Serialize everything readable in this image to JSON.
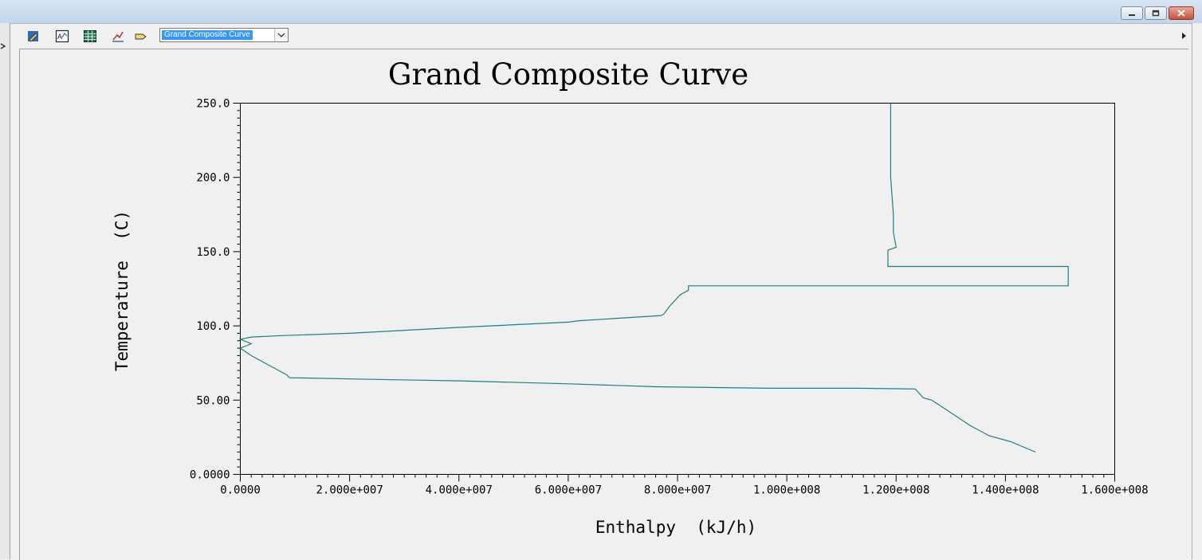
{
  "window": {
    "controls": [
      "minimize",
      "restore",
      "close"
    ]
  },
  "toolbar": {
    "icons": [
      "edit-icon",
      "format-chart-icon",
      "table-icon",
      "graph-control-icon",
      "label-icon"
    ],
    "chart_select": {
      "value": "Grand Composite Curve"
    }
  },
  "colors": {
    "curve": "#1f7f80",
    "axis": "#000000",
    "background": "#f0f0f0"
  },
  "chart_data": {
    "type": "line",
    "title": "Grand Composite Curve",
    "xlabel": "Enthalpy  (kJ/h)",
    "ylabel": "Temperature  (C)",
    "xlim": [
      0,
      160000000
    ],
    "ylim": [
      0,
      250
    ],
    "x_tick_labels": [
      "0.0000",
      "2.000e+007",
      "4.000e+007",
      "6.000e+007",
      "8.000e+007",
      "1.000e+008",
      "1.200e+008",
      "1.400e+008",
      "1.600e+008"
    ],
    "y_tick_labels": [
      "0.0000",
      "50.00",
      "100.0",
      "150.0",
      "200.0",
      "250.0"
    ],
    "grid": false,
    "series": [
      {
        "points": [
          [
            145500000,
            15
          ],
          [
            141000000,
            22
          ],
          [
            137000000,
            26
          ],
          [
            133500000,
            33
          ],
          [
            129000000,
            44
          ],
          [
            126500000,
            50
          ],
          [
            125000000,
            51.5
          ],
          [
            123500000,
            57.5
          ],
          [
            113000000,
            58
          ],
          [
            97000000,
            58
          ],
          [
            87000000,
            58.5
          ],
          [
            76000000,
            59
          ],
          [
            60000000,
            61
          ],
          [
            40000000,
            63
          ],
          [
            24000000,
            64
          ],
          [
            10000000,
            65
          ],
          [
            9000000,
            65
          ],
          [
            8500000,
            67
          ],
          [
            7000000,
            70
          ],
          [
            5000000,
            74
          ],
          [
            2000000,
            80
          ],
          [
            0,
            85
          ],
          [
            2000000,
            88
          ],
          [
            0,
            91
          ],
          [
            2000000,
            92.5
          ],
          [
            8000000,
            93.5
          ],
          [
            20000000,
            95
          ],
          [
            40000000,
            99
          ],
          [
            60000000,
            102.5
          ],
          [
            62000000,
            103.5
          ],
          [
            77000000,
            107
          ],
          [
            77500000,
            108
          ],
          [
            78500000,
            113
          ],
          [
            80500000,
            121
          ],
          [
            82000000,
            124
          ],
          [
            82000000,
            127
          ],
          [
            151500000,
            127
          ],
          [
            151500000,
            140
          ],
          [
            118500000,
            140
          ],
          [
            118500000,
            151
          ],
          [
            120000000,
            153
          ],
          [
            119500000,
            163
          ],
          [
            119500000,
            175
          ],
          [
            119000000,
            200
          ],
          [
            119000000,
            250
          ]
        ]
      }
    ]
  }
}
